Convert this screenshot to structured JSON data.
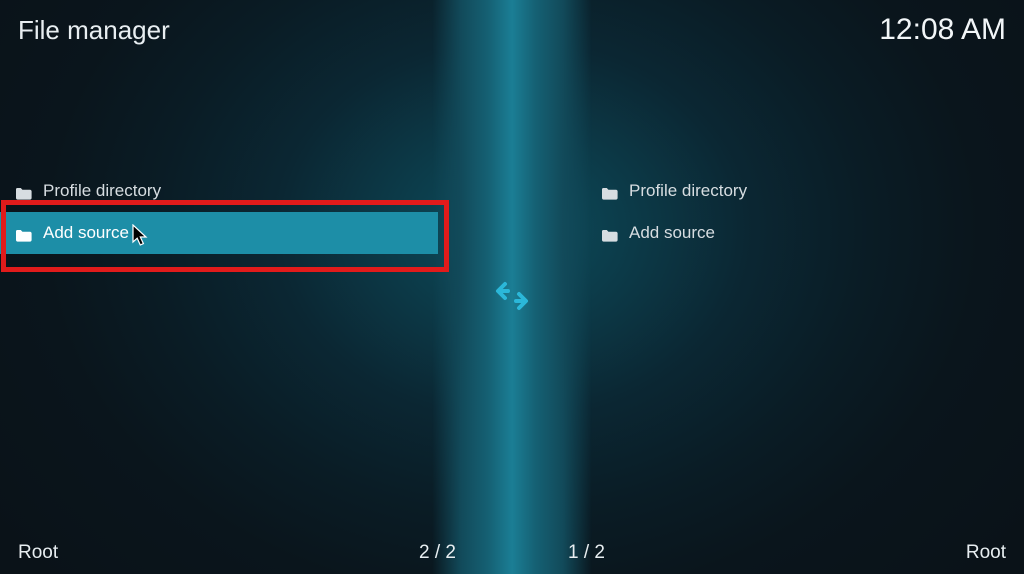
{
  "header": {
    "title": "File manager",
    "clock": "12:08 AM"
  },
  "panes": {
    "left": {
      "items": [
        {
          "label": "Profile directory"
        },
        {
          "label": "Add source"
        }
      ],
      "selected_index": 1,
      "footer_label": "Root",
      "footer_count": "2 / 2"
    },
    "right": {
      "items": [
        {
          "label": "Profile directory"
        },
        {
          "label": "Add source"
        }
      ],
      "footer_label": "Root",
      "footer_count": "1 / 2"
    }
  }
}
